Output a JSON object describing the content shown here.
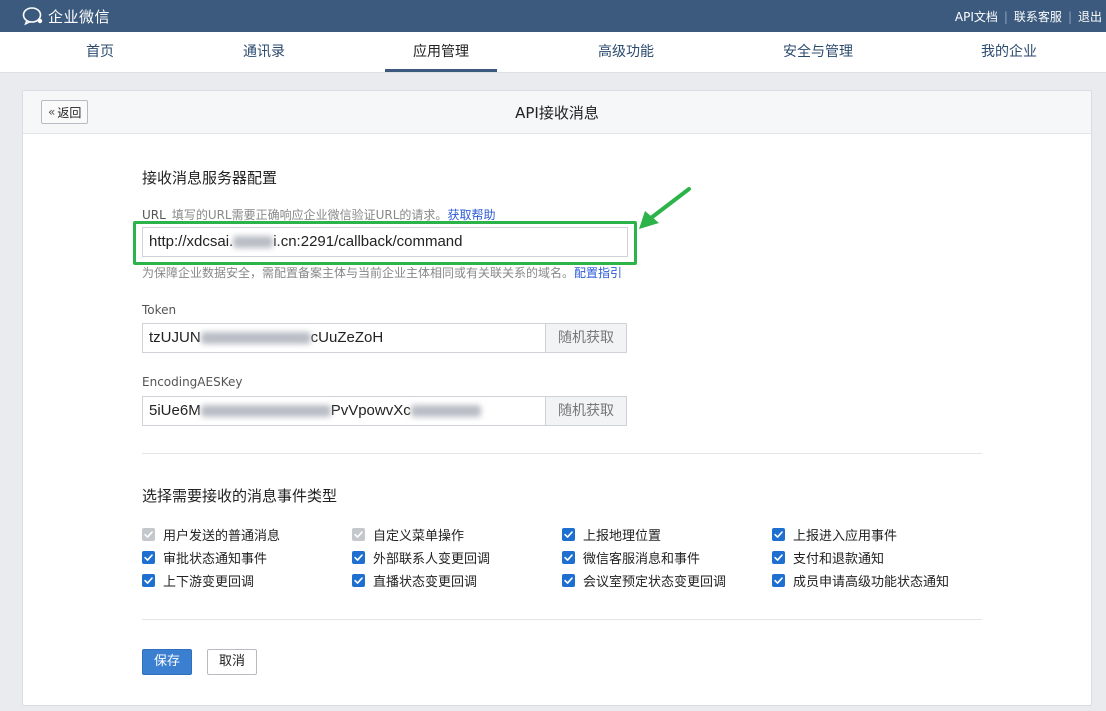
{
  "topbar": {
    "brand": "企业微信",
    "links": [
      "API文档",
      "联系客服",
      "退出"
    ]
  },
  "nav": {
    "items": [
      "首页",
      "通讯录",
      "应用管理",
      "高级功能",
      "安全与管理",
      "我的企业"
    ],
    "active": "应用管理"
  },
  "card": {
    "back_label": "返回",
    "title": "API接收消息"
  },
  "server_config": {
    "title": "接收消息服务器配置",
    "url": {
      "label": "URL",
      "hint": "填写的URL需要正确响应企业微信验证URL的请求。",
      "help_link": "获取帮助",
      "value_prefix": "http://xdcsai.",
      "value_suffix": "i.cn:2291/callback/command",
      "note": "为保障企业数据安全，需配置备案主体与当前企业主体相同或有关联关系的域名。",
      "note_link": "配置指引"
    },
    "token": {
      "label": "Token",
      "value_prefix": "tzUJUN",
      "value_suffix": "cUuZeZoH",
      "random_button": "随机获取"
    },
    "aes_key": {
      "label": "EncodingAESKey",
      "value_prefix": "5iUe6M",
      "value_middle": "PvVpowvXc",
      "random_button": "随机获取"
    }
  },
  "events": {
    "title": "选择需要接收的消息事件类型",
    "items": [
      {
        "label": "用户发送的普通消息",
        "checked": true,
        "disabled": true
      },
      {
        "label": "自定义菜单操作",
        "checked": true,
        "disabled": true
      },
      {
        "label": "上报地理位置",
        "checked": true,
        "disabled": false
      },
      {
        "label": "上报进入应用事件",
        "checked": true,
        "disabled": false
      },
      {
        "label": "审批状态通知事件",
        "checked": true,
        "disabled": false
      },
      {
        "label": "外部联系人变更回调",
        "checked": true,
        "disabled": false
      },
      {
        "label": "微信客服消息和事件",
        "checked": true,
        "disabled": false
      },
      {
        "label": "支付和退款通知",
        "checked": true,
        "disabled": false
      },
      {
        "label": "上下游变更回调",
        "checked": true,
        "disabled": false
      },
      {
        "label": "直播状态变更回调",
        "checked": true,
        "disabled": false
      },
      {
        "label": "会议室预定状态变更回调",
        "checked": true,
        "disabled": false
      },
      {
        "label": "成员申请高级功能状态通知",
        "checked": true,
        "disabled": false
      }
    ]
  },
  "actions": {
    "save": "保存",
    "cancel": "取消"
  },
  "colors": {
    "topbar": "#3b5a7e",
    "highlight": "#2cb34a",
    "checkbox": "#1f6fd1",
    "primary": "#3b7fd1"
  }
}
